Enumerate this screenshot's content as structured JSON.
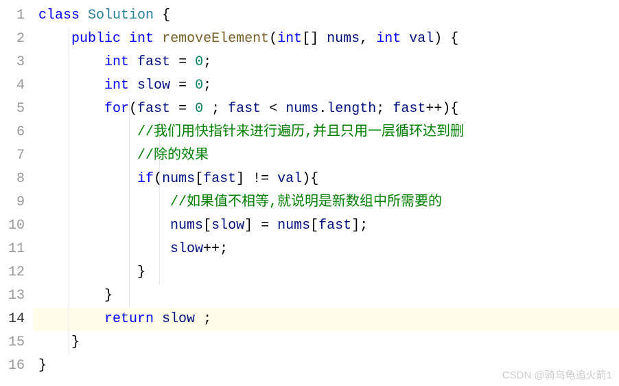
{
  "lineNumbers": [
    "1",
    "2",
    "3",
    "4",
    "5",
    "6",
    "7",
    "8",
    "9",
    "10",
    "11",
    "12",
    "13",
    "14",
    "15",
    "16"
  ],
  "highlightedLine": 14,
  "code": {
    "line1": {
      "kw_class": "class",
      "classname": "Solution",
      "brace": "{"
    },
    "line2": {
      "kw_public": "public",
      "type_int": "int",
      "method": "removeElement",
      "paren_open": "(",
      "param1_type": "int",
      "brackets": "[]",
      "param1_name": "nums",
      "comma": ",",
      "param2_type": "int",
      "param2_name": "val",
      "paren_close": ")",
      "brace": "{"
    },
    "line3": {
      "type": "int",
      "var": "fast",
      "eq": "=",
      "val": "0",
      "semi": ";"
    },
    "line4": {
      "type": "int",
      "var": "slow",
      "eq": "=",
      "val": "0",
      "semi": ";"
    },
    "line5": {
      "kw_for": "for",
      "paren_open": "(",
      "var1": "fast",
      "eq": "=",
      "val": "0",
      "semi1": ";",
      "var2": "fast",
      "lt": "<",
      "obj": "nums",
      "dot": ".",
      "prop": "length",
      "semi2": ";",
      "var3": "fast",
      "inc": "++",
      "paren_close": ")",
      "brace": "{"
    },
    "line6": {
      "comment": "//我们用快指针来进行遍历,并且只用一层循环达到删"
    },
    "line7": {
      "comment": "//除的效果"
    },
    "line8": {
      "kw_if": "if",
      "paren_open": "(",
      "obj": "nums",
      "bopen": "[",
      "idx": "fast",
      "bclose": "]",
      "neq": "!=",
      "var": "val",
      "paren_close": ")",
      "brace": "{"
    },
    "line9": {
      "comment": "//如果值不相等,就说明是新数组中所需要的"
    },
    "line10": {
      "obj1": "nums",
      "bopen1": "[",
      "idx1": "slow",
      "bclose1": "]",
      "eq": "=",
      "obj2": "nums",
      "bopen2": "[",
      "idx2": "fast",
      "bclose2": "]",
      "semi": ";"
    },
    "line11": {
      "var": "slow",
      "inc": "++",
      "semi": ";"
    },
    "line12": {
      "brace": "}"
    },
    "line13": {
      "brace": "}"
    },
    "line14": {
      "kw_return": "return",
      "var": "slow",
      "semi": ";"
    },
    "line15": {
      "brace": "}"
    },
    "line16": {
      "brace": "}"
    }
  },
  "watermark": "CSDN @骑乌龟追火箭1"
}
